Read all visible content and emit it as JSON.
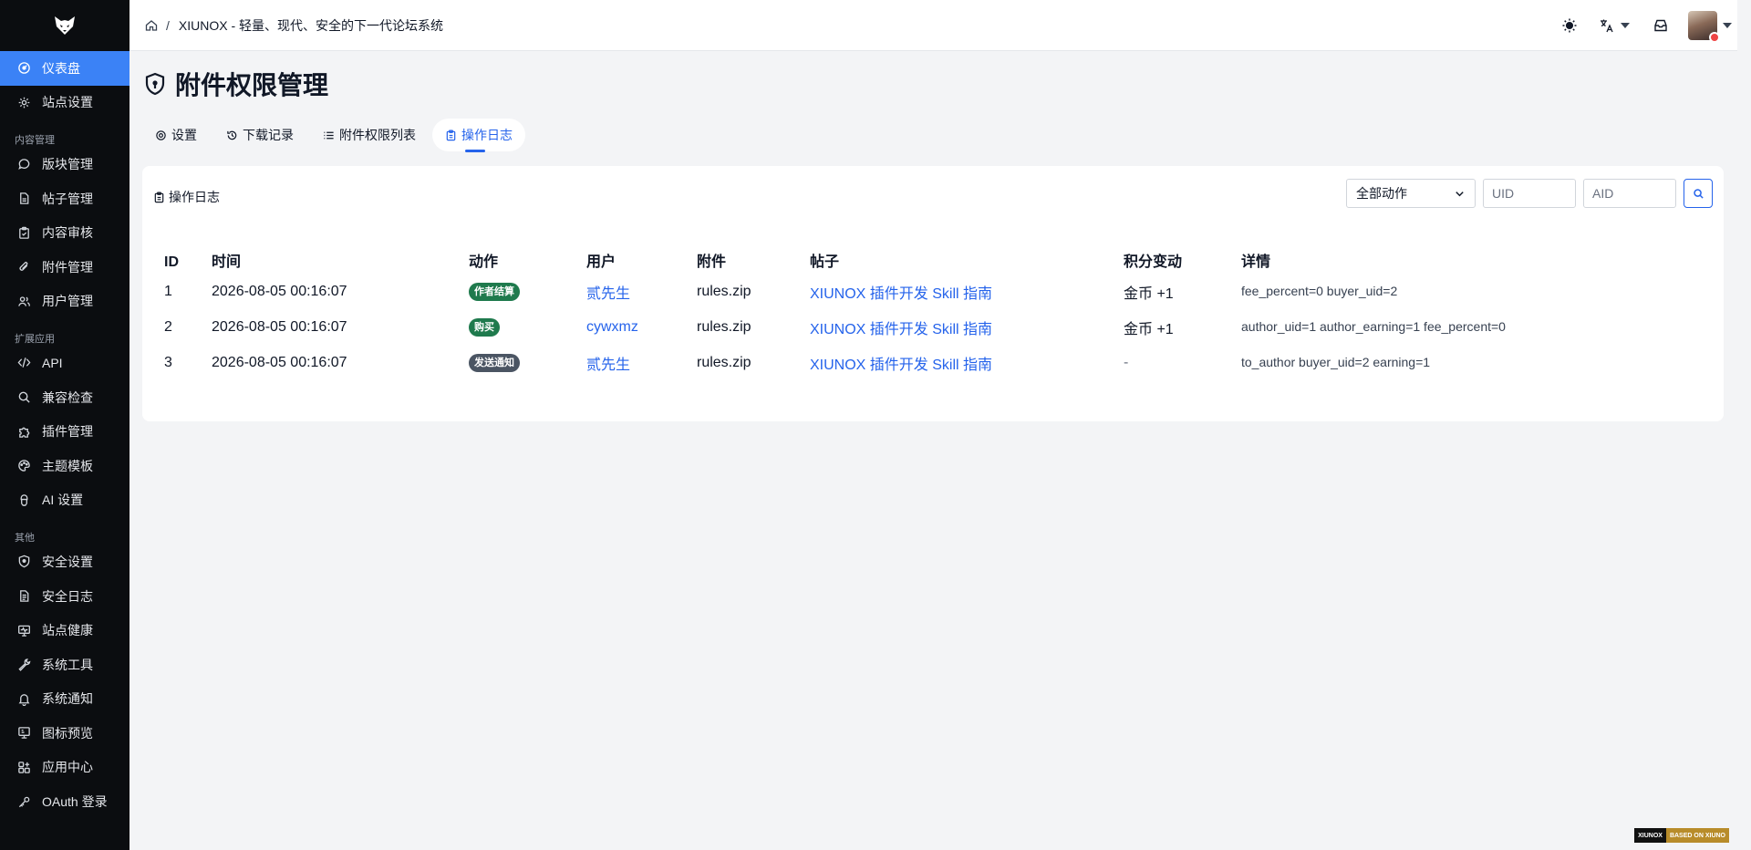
{
  "sidebar": {
    "items": [
      {
        "label": "仪表盘",
        "icon": "dashboard-icon",
        "active": true
      },
      {
        "label": "站点设置",
        "icon": "gear-icon"
      },
      {
        "group": "内容管理"
      },
      {
        "label": "版块管理",
        "icon": "chat-bubble-icon"
      },
      {
        "label": "帖子管理",
        "icon": "document-icon"
      },
      {
        "label": "内容审核",
        "icon": "clipboard-check-icon"
      },
      {
        "label": "附件管理",
        "icon": "paperclip-icon"
      },
      {
        "label": "用户管理",
        "icon": "users-icon"
      },
      {
        "group": "扩展应用"
      },
      {
        "label": "API",
        "icon": "code-icon"
      },
      {
        "label": "兼容检查",
        "icon": "search-icon"
      },
      {
        "label": "插件管理",
        "icon": "puzzle-icon"
      },
      {
        "label": "主题模板",
        "icon": "palette-icon"
      },
      {
        "label": "AI 设置",
        "icon": "robot-icon"
      },
      {
        "group": "其他"
      },
      {
        "label": "安全设置",
        "icon": "shield-icon"
      },
      {
        "label": "安全日志",
        "icon": "log-document-icon"
      },
      {
        "label": "站点健康",
        "icon": "monitor-heart-icon"
      },
      {
        "label": "系统工具",
        "icon": "wrench-icon"
      },
      {
        "label": "系统通知",
        "icon": "bell-icon"
      },
      {
        "label": "图标预览",
        "icon": "grid-icon"
      },
      {
        "label": "应用中心",
        "icon": "apps-icon"
      },
      {
        "label": "OAuth 登录",
        "icon": "key-icon"
      }
    ]
  },
  "topbar": {
    "breadcrumb_sep": "/",
    "breadcrumb_title": "XIUNOX - 轻量、现代、安全的下一代论坛系统"
  },
  "page": {
    "title": "附件权限管理"
  },
  "tabs": [
    {
      "label": "设置",
      "icon": "gear-icon"
    },
    {
      "label": "下载记录",
      "icon": "history-icon"
    },
    {
      "label": "附件权限列表",
      "icon": "list-icon"
    },
    {
      "label": "操作日志",
      "icon": "clipboard-icon",
      "active": true
    }
  ],
  "card": {
    "title": "操作日志",
    "filter_select": "全部动作",
    "uid_placeholder": "UID",
    "aid_placeholder": "AID"
  },
  "table": {
    "headers": [
      "ID",
      "时间",
      "动作",
      "用户",
      "附件",
      "帖子",
      "积分变动",
      "详情"
    ],
    "rows": [
      {
        "id": "1",
        "time": "2026-08-05 00:16:07",
        "action": "作者结算",
        "action_color": "#1f7a4d",
        "user": "贰先生",
        "attachment": "rules.zip",
        "post": "XIUNOX 插件开发 Skill 指南",
        "points": "金币 +1",
        "detail": "fee_percent=0 buyer_uid=2"
      },
      {
        "id": "2",
        "time": "2026-08-05 00:16:07",
        "action": "购买",
        "action_color": "#1f7a4d",
        "user": "cywxmz",
        "attachment": "rules.zip",
        "post": "XIUNOX 插件开发 Skill 指南",
        "points": "金币 +1",
        "detail": "author_uid=1 author_earning=1 fee_percent=0"
      },
      {
        "id": "3",
        "time": "2026-08-05 00:16:07",
        "action": "发送通知",
        "action_color": "#4b5563",
        "user": "贰先生",
        "attachment": "rules.zip",
        "post": "XIUNOX 插件开发 Skill 指南",
        "points": "-",
        "detail": "to_author buyer_uid=2 earning=1"
      }
    ]
  },
  "footer_badge": {
    "left": "XIUNOX",
    "right": "BASED ON XIUNO"
  }
}
